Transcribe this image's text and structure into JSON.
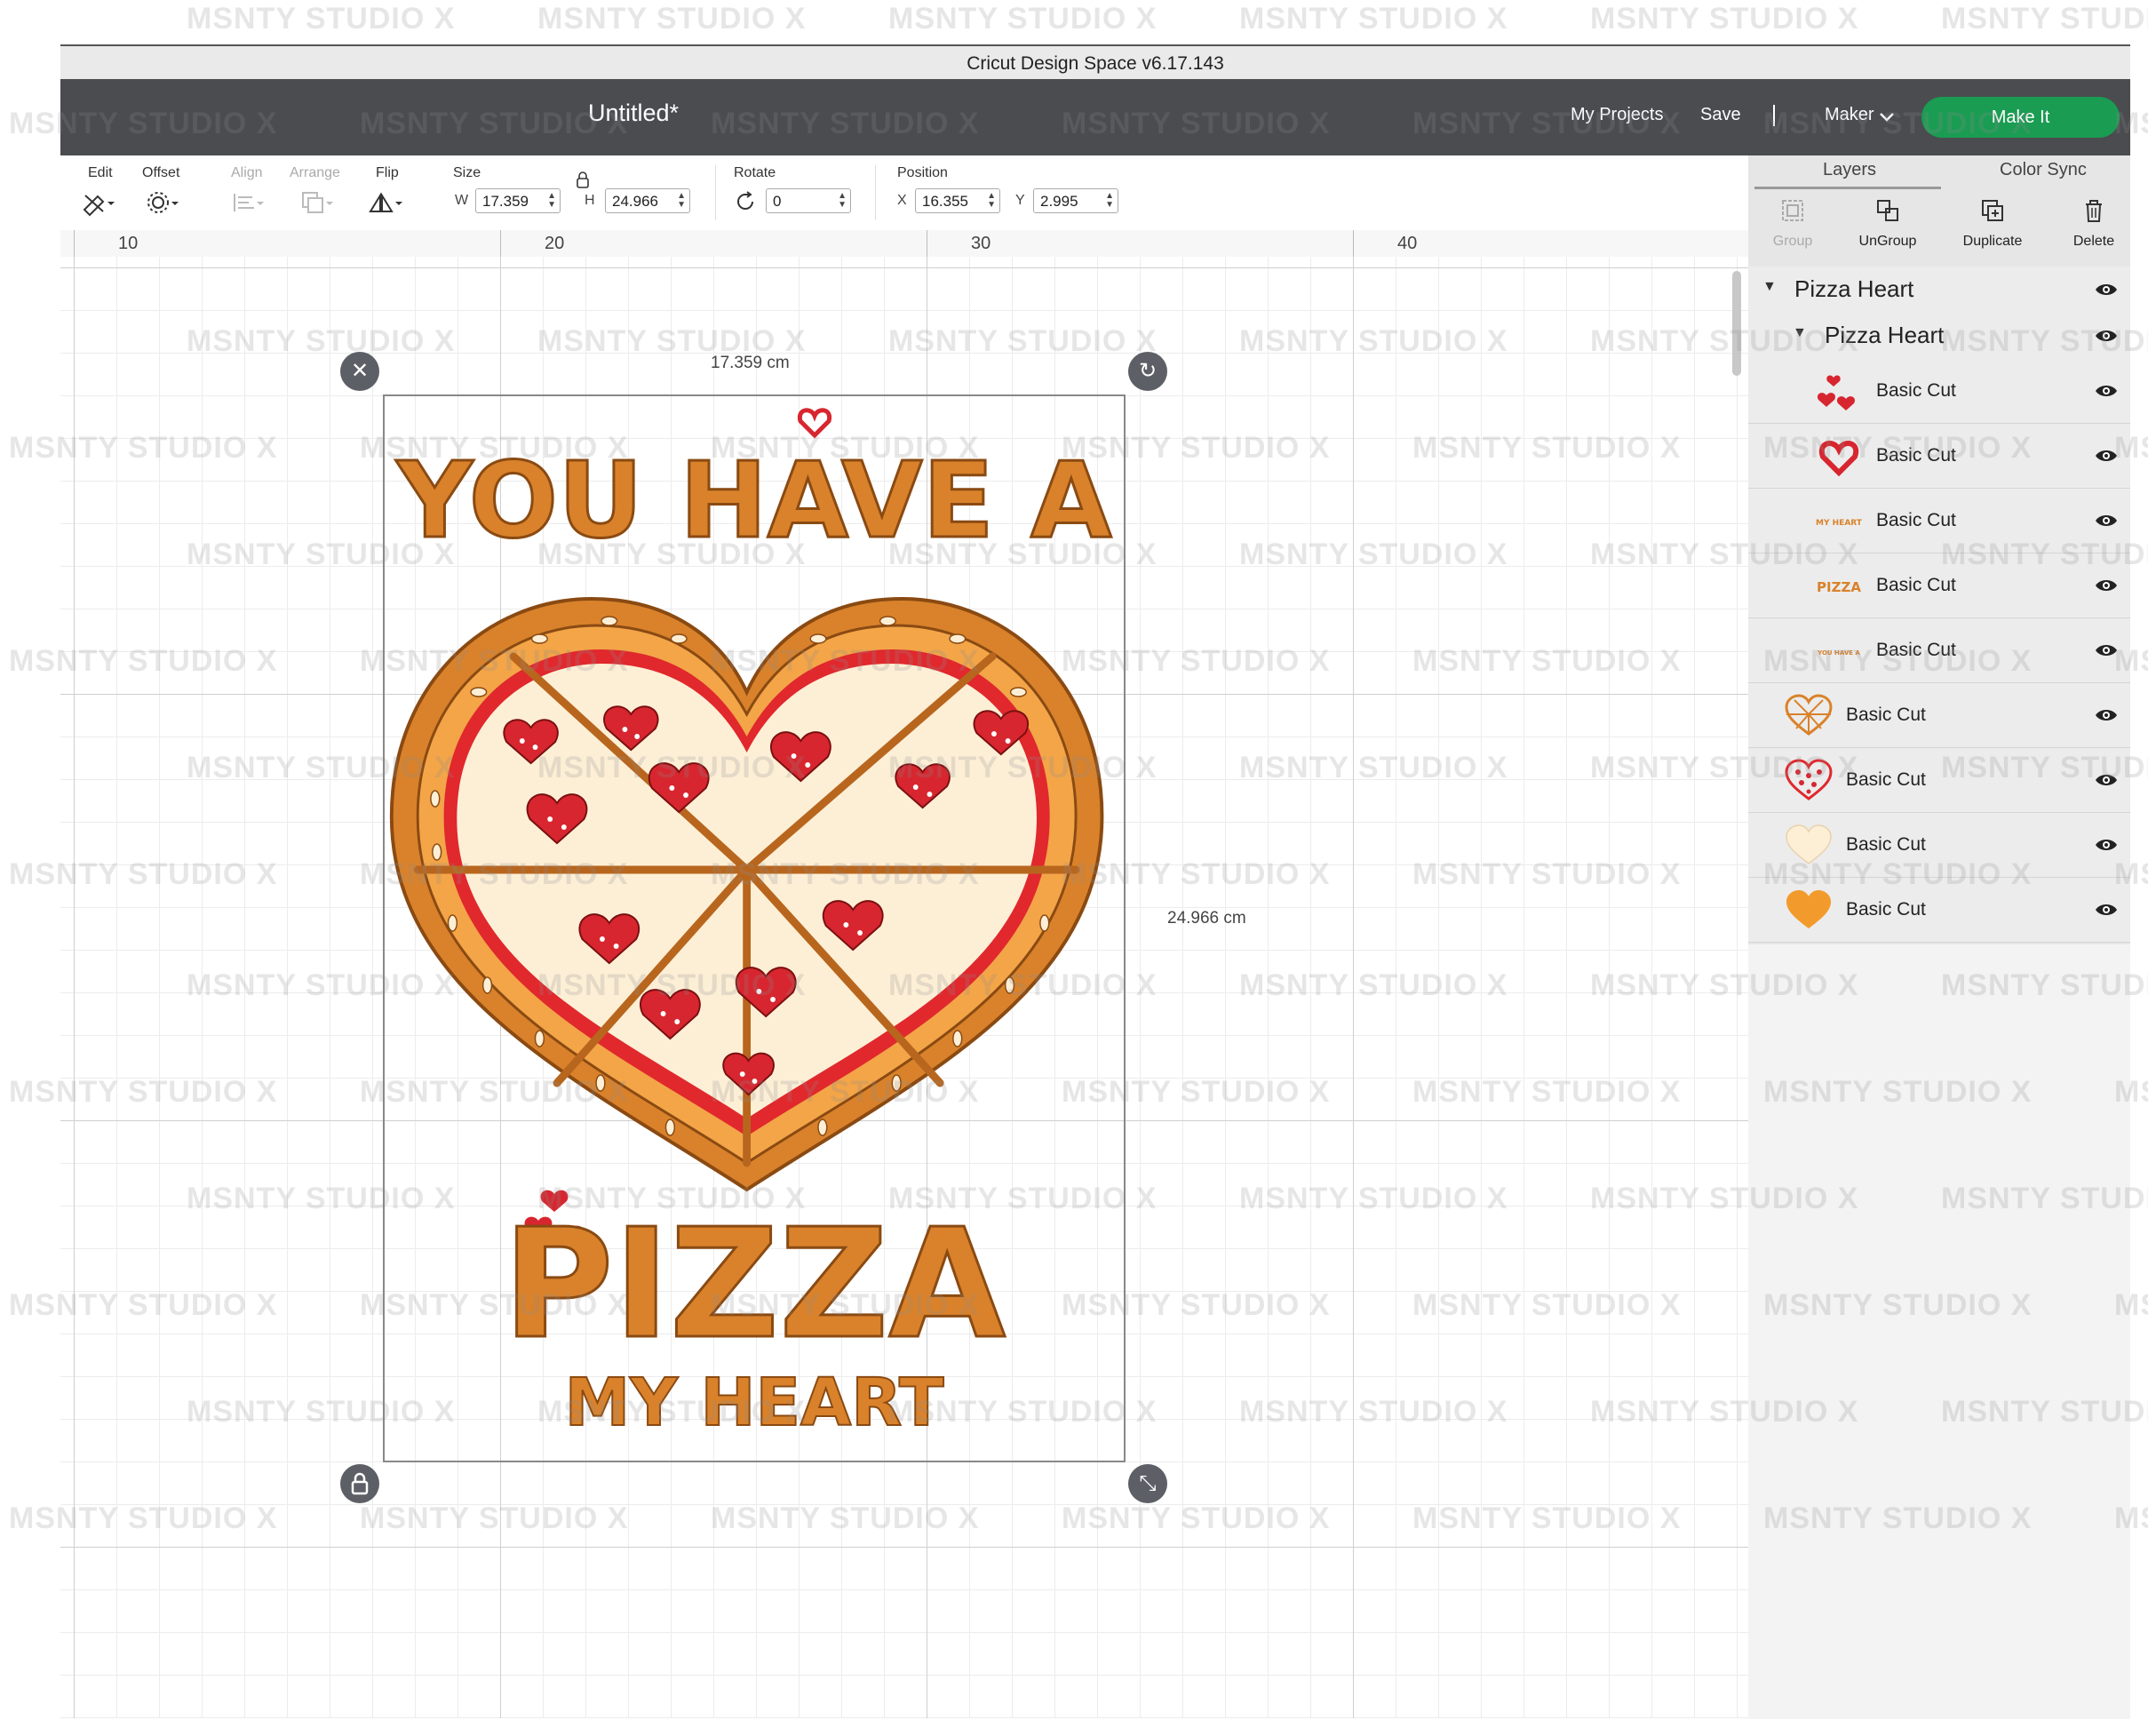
{
  "app": {
    "window_title": "Cricut Design Space  v6.17.143",
    "document_title": "Untitled*",
    "header_links": [
      "My Projects",
      "Save"
    ],
    "machine": "Maker",
    "make_it": "Make It"
  },
  "toolbar": {
    "edit_label": "Edit",
    "offset_label": "Offset",
    "align_label": "Align",
    "arrange_label": "Arrange",
    "flip_label": "Flip",
    "size_label": "Size",
    "w_tag": "W",
    "w_value": "17.359",
    "h_tag": "H",
    "h_value": "24.966",
    "rotate_label": "Rotate",
    "rotate_value": "0",
    "position_label": "Position",
    "x_tag": "X",
    "x_value": "16.355",
    "y_tag": "Y",
    "y_value": "2.995"
  },
  "ruler": [
    "10",
    "20",
    "30",
    "40"
  ],
  "canvas": {
    "width_label": "17.359 cm",
    "height_label": "24.966 cm",
    "design_text": {
      "line1": "YOU HAVE A",
      "line2": "PIZZA",
      "line3": "MY HEART"
    },
    "colors": {
      "crust": "#d9822b",
      "crust_light": "#f0a441",
      "cheese": "#fdefd6",
      "sauce": "#e02b2b",
      "outline": "#b8661e",
      "heart": "#d7262f"
    }
  },
  "layers_panel": {
    "tabs": [
      "Layers",
      "Color Sync"
    ],
    "actions": [
      "Group",
      "UnGroup",
      "Duplicate",
      "Delete"
    ],
    "group": "Pizza Heart",
    "subgroup": "Pizza Heart",
    "items": [
      {
        "name": "Basic Cut",
        "thumb": "hearts-icon"
      },
      {
        "name": "Basic Cut",
        "thumb": "heart-outline-icon"
      },
      {
        "name": "Basic Cut",
        "thumb": "my-heart-text-icon",
        "thumb_text": "MY HEART"
      },
      {
        "name": "Basic Cut",
        "thumb": "pizza-text-icon",
        "thumb_text": "PIZZA"
      },
      {
        "name": "Basic Cut",
        "thumb": "you-have-a-text-icon",
        "thumb_text": "YOU HAVE A"
      },
      {
        "name": "Basic Cut",
        "thumb": "pizza-slices-icon"
      },
      {
        "name": "Basic Cut",
        "thumb": "pepperoni-hearts-icon"
      },
      {
        "name": "Basic Cut",
        "thumb": "cheese-icon"
      },
      {
        "name": "Basic Cut",
        "thumb": "crust-heart-icon"
      }
    ]
  },
  "watermark": "MSNTY STUDIO X"
}
